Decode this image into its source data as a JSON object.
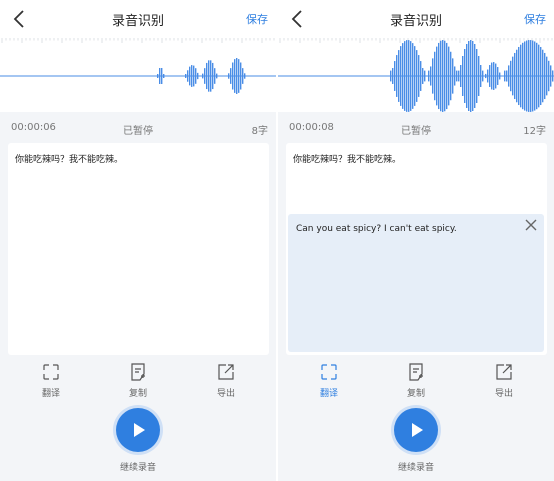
{
  "left": {
    "header": {
      "title": "录音识别",
      "save_label": "保存",
      "back_icon": "chevron-left-icon"
    },
    "status": {
      "time": "00:00:06",
      "state": "已暂停",
      "count": "8字"
    },
    "transcript": "你能吃辣吗？我不能吃辣。",
    "actions": [
      {
        "label": "翻译",
        "icon": "translate-icon",
        "active": false
      },
      {
        "label": "复制",
        "icon": "copy-icon",
        "active": false
      },
      {
        "label": "导出",
        "icon": "export-icon",
        "active": false
      }
    ],
    "record_label": "继续录音"
  },
  "right": {
    "header": {
      "title": "录音识别",
      "save_label": "保存",
      "back_icon": "chevron-left-icon"
    },
    "status": {
      "time": "00:00:08",
      "state": "已暂停",
      "count": "12字"
    },
    "transcript": "你能吃辣吗？我不能吃辣。",
    "translation": "Can you eat spicy? I can't eat spicy.",
    "actions": [
      {
        "label": "翻译",
        "icon": "translate-icon",
        "active": true
      },
      {
        "label": "复制",
        "icon": "copy-icon",
        "active": false
      },
      {
        "label": "导出",
        "icon": "export-icon",
        "active": false
      }
    ],
    "record_label": "继续录音"
  },
  "colors": {
    "accent": "#2f7fe0",
    "wave": "#4a8de6",
    "background": "#f3f5f8",
    "translation_bg": "#e6eef8"
  }
}
